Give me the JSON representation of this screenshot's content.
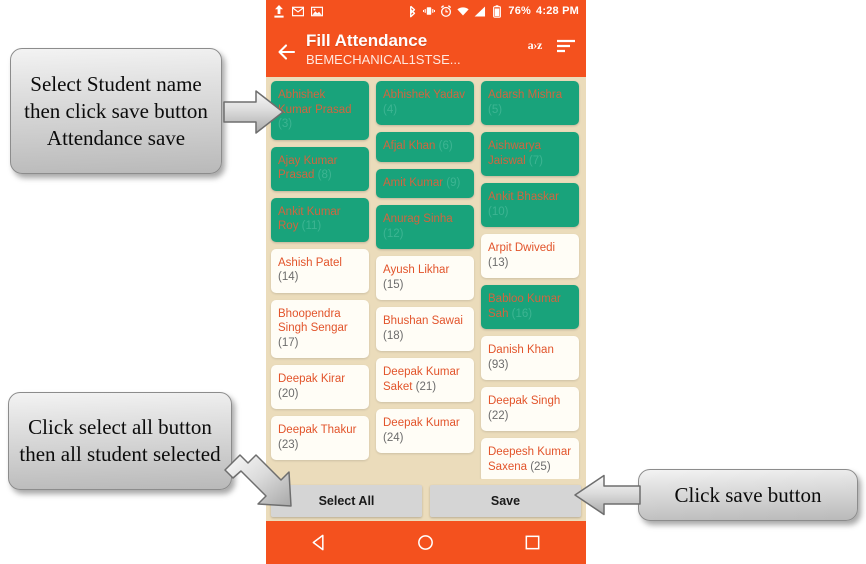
{
  "status_bar": {
    "icons_left": [
      "upload-icon",
      "mail-icon",
      "screenshot-icon"
    ],
    "icons_right": [
      "bluetooth-icon",
      "vibrate-icon",
      "alarm-icon",
      "wifi-icon",
      "signal-icon",
      "battery-icon"
    ],
    "battery_percent": "76%",
    "time": "4:28 PM"
  },
  "app_bar": {
    "back_icon": "back-arrow-icon",
    "title": "Fill Attendance",
    "subtitle": "BEMECHANICAL1STSE...",
    "sort_alpha_label": "a›z",
    "sort_icon": "sort-lines-icon"
  },
  "grid": {
    "columns": [
      {
        "cells": [
          {
            "name": "Abhishek Kumar Prasad",
            "roll": "(3)",
            "selected": true
          },
          {
            "name": "Ajay Kumar Prasad",
            "roll": "(8)",
            "selected": true
          },
          {
            "name": "Ankit Kumar Roy",
            "roll": "(11)",
            "selected": true
          },
          {
            "name": "Ashish Patel",
            "roll": "(14)",
            "selected": false
          },
          {
            "name": "Bhoopendra Singh Sengar",
            "roll": "(17)",
            "selected": false
          },
          {
            "name": "Deepak Kirar",
            "roll": "(20)",
            "selected": false
          },
          {
            "name": "Deepak Thakur",
            "roll": "(23)",
            "selected": false
          }
        ]
      },
      {
        "cells": [
          {
            "name": "Abhishek Yadav",
            "roll": "(4)",
            "selected": true
          },
          {
            "name": "Afjal Khan",
            "roll": "(6)",
            "selected": true
          },
          {
            "name": "Amit Kumar",
            "roll": "(9)",
            "selected": true
          },
          {
            "name": "Anurag Sinha",
            "roll": "(12)",
            "selected": true
          },
          {
            "name": "Ayush Likhar",
            "roll": "(15)",
            "selected": false
          },
          {
            "name": "Bhushan Sawai",
            "roll": "(18)",
            "selected": false
          },
          {
            "name": "Deepak Kumar Saket",
            "roll": "(21)",
            "selected": false
          },
          {
            "name": "Deepak Kumar",
            "roll": "(24)",
            "selected": false
          }
        ]
      },
      {
        "cells": [
          {
            "name": "Adarsh Mishra",
            "roll": "(5)",
            "selected": true
          },
          {
            "name": "Aishwarya Jaiswal",
            "roll": "(7)",
            "selected": true
          },
          {
            "name": "Ankit Bhaskar",
            "roll": "(10)",
            "selected": true
          },
          {
            "name": "Arpit Dwivedi",
            "roll": "(13)",
            "selected": false
          },
          {
            "name": "Babloo Kumar Sah",
            "roll": "(16)",
            "selected": true
          },
          {
            "name": "Danish Khan",
            "roll": "(93)",
            "selected": false
          },
          {
            "name": "Deepak Singh",
            "roll": "(22)",
            "selected": false
          },
          {
            "name": "Deepesh Kumar Saxena",
            "roll": "(25)",
            "selected": false
          }
        ]
      }
    ]
  },
  "actions": {
    "select_all_label": "Select All",
    "save_label": "Save"
  },
  "nav_bar": {
    "back": "nav-back-triangle-icon",
    "home": "nav-home-circle-icon",
    "recents": "nav-recents-square-icon"
  },
  "annotations": [
    {
      "text": "Select Student name then click save  button Attendance save"
    },
    {
      "text": "Click select all button then all student selected"
    },
    {
      "text": "Click save button"
    }
  ],
  "colors": {
    "accent": "#F4511E",
    "selected_cell": "#19A37B",
    "unselected_cell": "#FFFDF6",
    "page_background": "#EBDCBB",
    "name_text": "#E2542B",
    "button": "#D5D5D5"
  }
}
